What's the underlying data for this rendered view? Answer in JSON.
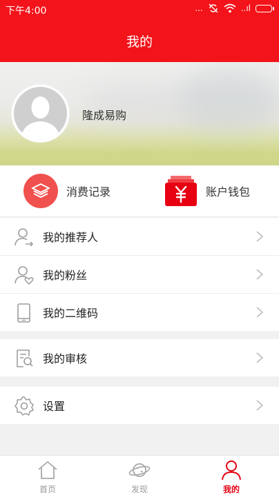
{
  "status_bar": {
    "time": "下午4:00",
    "dots": "...",
    "signal": "..ıl"
  },
  "header": {
    "title": "我的"
  },
  "profile": {
    "name": "隆成易购"
  },
  "quick_actions": [
    {
      "label": "消费记录",
      "icon": "layers-icon"
    },
    {
      "label": "账户钱包",
      "icon": "wallet-yuan-icon"
    }
  ],
  "menu_groups": [
    [
      {
        "label": "我的推荐人",
        "icon": "user-arrow-icon"
      },
      {
        "label": "我的粉丝",
        "icon": "user-heart-icon"
      },
      {
        "label": "我的二维码",
        "icon": "phone-icon"
      }
    ],
    [
      {
        "label": "我的审核",
        "icon": "document-search-icon"
      }
    ],
    [
      {
        "label": "设置",
        "icon": "gear-icon"
      }
    ]
  ],
  "tabs": [
    {
      "label": "首页",
      "icon": "home-icon",
      "active": false
    },
    {
      "label": "发现",
      "icon": "planet-icon",
      "active": false
    },
    {
      "label": "我的",
      "icon": "user-icon",
      "active": true
    }
  ],
  "colors": {
    "brand_red": "#f3131a",
    "active_tab": "#e60012",
    "icon_gray": "#9c9c9c"
  }
}
